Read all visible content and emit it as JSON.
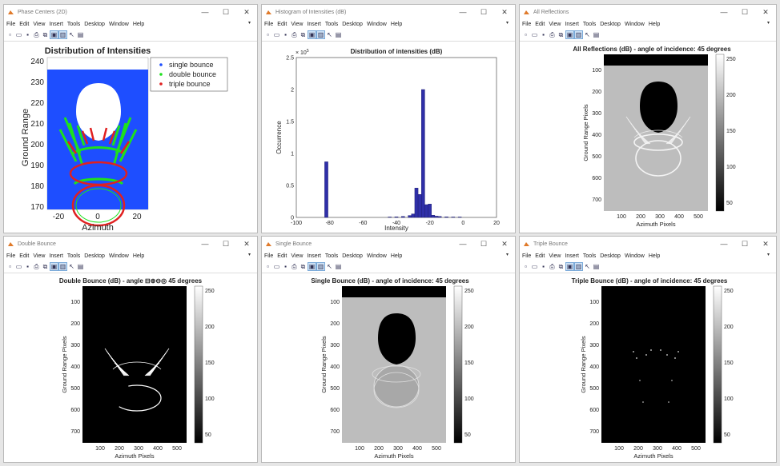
{
  "colors": {
    "accent": "#2f2fa8",
    "blue": "#1e4eff",
    "green": "#1ee01e",
    "red": "#e02020"
  },
  "menu": [
    "File",
    "Edit",
    "View",
    "Insert",
    "Tools",
    "Desktop",
    "Window",
    "Help"
  ],
  "windows": {
    "phase": {
      "title": "Phase Centers (2D)"
    },
    "hist": {
      "title": "Histogram of Intensities (dB)"
    },
    "allref": {
      "title": "All Reflections"
    },
    "double": {
      "title": "Double Bounce"
    },
    "single": {
      "title": "Single Bounce"
    },
    "triple": {
      "title": "Triple Bounce"
    }
  },
  "phase_plot": {
    "title": "Distribution of Intensities",
    "xlabel": "Azimuth",
    "ylabel": "Ground Range",
    "xticks": [
      "-20",
      "0",
      "20"
    ],
    "yticks": [
      "240",
      "230",
      "220",
      "210",
      "200",
      "190",
      "180",
      "170"
    ],
    "legend": [
      "single bounce",
      "double bounce",
      "triple bounce"
    ]
  },
  "chart_data": {
    "type": "bar",
    "title": "Distribution of intensities (dB)",
    "xlabel": "Intensity",
    "ylabel": "Occurrence",
    "exponent_label": "× 10",
    "exponent_power": "5",
    "xlim": [
      -100,
      20
    ],
    "ylim": [
      0,
      250000
    ],
    "xticks": [
      "-100",
      "-80",
      "-60",
      "-40",
      "-20",
      "0",
      "20"
    ],
    "yticks": [
      "0",
      "0.5",
      "1",
      "1.5",
      "2",
      "2.5"
    ],
    "bins": [
      {
        "x": -82,
        "value": 87000
      },
      {
        "x": -44,
        "value": 700
      },
      {
        "x": -40,
        "value": 1000
      },
      {
        "x": -36,
        "value": 1500
      },
      {
        "x": -32,
        "value": 3000
      },
      {
        "x": -30,
        "value": 5500
      },
      {
        "x": -28,
        "value": 46000
      },
      {
        "x": -26,
        "value": 36000
      },
      {
        "x": -24,
        "value": 200000
      },
      {
        "x": -22,
        "value": 20000
      },
      {
        "x": -20,
        "value": 21000
      },
      {
        "x": -18,
        "value": 3500
      },
      {
        "x": -16,
        "value": 2000
      },
      {
        "x": -14,
        "value": 1500
      },
      {
        "x": -10,
        "value": 1000
      },
      {
        "x": -6,
        "value": 700
      },
      {
        "x": -2,
        "value": 700
      }
    ]
  },
  "image_plots": {
    "allref": {
      "title": "All Reflections (dB) - angle of incidence: 45 degrees"
    },
    "double": {
      "title": "Double Bounce (dB) - angle",
      "title_tail": "45 degrees"
    },
    "single": {
      "title": "Single Bounce (dB) - angle of incidence: 45 degrees"
    },
    "triple": {
      "title": "Triple Bounce (dB) - angle of incidence: 45 degrees"
    },
    "xlabel": "Azimuth Pixels",
    "ylabel": "Ground Range Pixels",
    "xticks": [
      "100",
      "200",
      "300",
      "400",
      "500"
    ],
    "yticks": [
      "100",
      "200",
      "300",
      "400",
      "500",
      "600",
      "700"
    ],
    "cbar_ticks": [
      "250",
      "200",
      "150",
      "100",
      "50"
    ]
  },
  "window_controls": {
    "min": "—",
    "max": "☐",
    "close": "✕"
  }
}
